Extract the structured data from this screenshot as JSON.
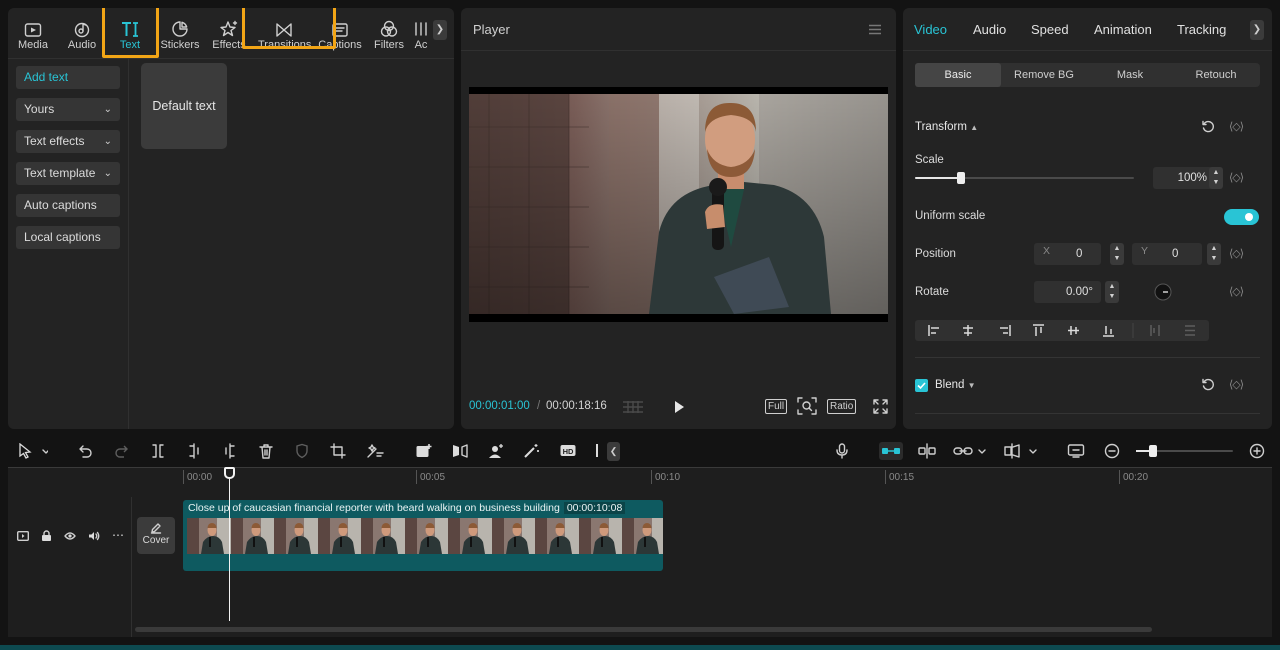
{
  "left_panel": {
    "tabs": [
      {
        "label": "Media",
        "icon": "media-icon"
      },
      {
        "label": "Audio",
        "icon": "audio-icon"
      },
      {
        "label": "Text",
        "icon": "text-icon",
        "active": true
      },
      {
        "label": "Stickers",
        "icon": "stickers-icon"
      },
      {
        "label": "Effects",
        "icon": "effects-icon"
      },
      {
        "label": "Transitions",
        "icon": "transitions-icon"
      },
      {
        "label": "Captions",
        "icon": "captions-icon"
      },
      {
        "label": "Filters",
        "icon": "filters-icon"
      },
      {
        "label": "Ac",
        "icon": "adjustment-icon"
      }
    ],
    "sidebar": [
      {
        "label": "Add text",
        "active": true
      },
      {
        "label": "Yours",
        "has_dropdown": true
      },
      {
        "label": "Text effects",
        "has_dropdown": true
      },
      {
        "label": "Text template",
        "has_dropdown": true
      },
      {
        "label": "Auto captions"
      },
      {
        "label": "Local captions"
      }
    ],
    "preset_card": "Default text",
    "highlight_color": "#f2a516"
  },
  "player": {
    "title": "Player",
    "current_time": "00:00:01:00",
    "separator": "/",
    "total_time": "00:00:18:16",
    "full_label": "Full",
    "ratio_label": "Ratio"
  },
  "right_panel": {
    "tabs": [
      "Video",
      "Audio",
      "Speed",
      "Animation",
      "Tracking"
    ],
    "active_tab": "Video",
    "subtabs": [
      "Basic",
      "Remove BG",
      "Mask",
      "Retouch"
    ],
    "active_subtab": "Basic",
    "transform_label": "Transform",
    "scale_label": "Scale",
    "scale_value": "100%",
    "scale_fraction": 0.21,
    "uniform_scale_label": "Uniform scale",
    "uniform_scale_on": true,
    "position_label": "Position",
    "x_label": "X",
    "x_value": "0",
    "y_label": "Y",
    "y_value": "0",
    "rotate_label": "Rotate",
    "rotate_value": "0.00°",
    "blend_label": "Blend",
    "accent_color": "#29c4d5"
  },
  "timeline": {
    "ruler": [
      "00:00",
      "00:05",
      "00:10",
      "00:15",
      "00:20"
    ],
    "cover_label": "Cover",
    "clip_title": "Close up of caucasian financial reporter with beard walking on business building",
    "clip_duration": "00:00:10:08",
    "zoom_fraction": 0.18
  }
}
